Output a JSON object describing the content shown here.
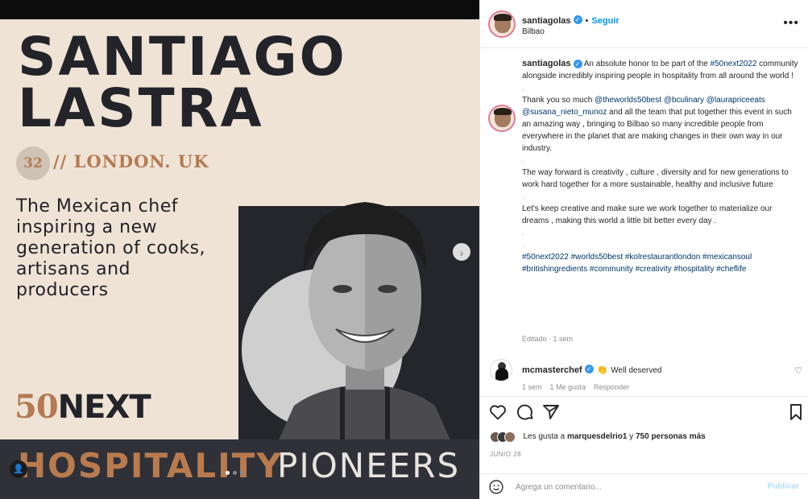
{
  "poster": {
    "name_line1": "SANTIAGO",
    "name_line2": "LASTRA",
    "number": "32",
    "location": "// LONDON. UK",
    "tagline": [
      "The Mexican chef",
      "inspiring a new",
      "generation of cooks,",
      "artisans and",
      "producers"
    ],
    "logo_number": "50",
    "logo_word": "NEXT",
    "banner_left": "HOSPITALITY",
    "banner_right": "PIONEERS"
  },
  "header": {
    "username": "santiagolas",
    "follow_label": "Seguir",
    "location": "Bilbao",
    "more_label": "•••"
  },
  "caption": {
    "username": "santiagolas",
    "intro_before": " An absolute honor to be part of the ",
    "intro_hashtag": "#50next2022",
    "intro_after": " community alongside incredibly inspiring people in hospitality from all around the world !",
    "sep": ".",
    "thanks_before": "Thank you so much ",
    "mention1": "@theworlds50best",
    "mention2": "@bculinary",
    "mention3": "@laurapriceeats",
    "mention4": "@susana_nieto_munoz",
    "thanks_after": " and all the team that put together this event in such an amazing way , bringing to Bilbao so many incredible people from everywhere in the planet that are making changes in their own way in our industry.",
    "forward": "The way forward is creativity , culture , diversity and for new generations to work hard together for a more sustainable, healthy and inclusive future",
    "keep": "Let's keep creative and make sure we work together to materialize our dreams , making this world a little bit better every day .",
    "hashtags": "#50next2022 #worlds50best #kolrestaurantlondon #mexicansoul #britishingredients #community #creativity #hospitality #cheflife",
    "meta": "Editado · 1 sem"
  },
  "comment": {
    "username": "mcmasterchef",
    "emoji": "👏",
    "text": "Well deserved",
    "meta_time": "1 sem",
    "meta_likes": "1 Me gusta",
    "meta_reply": "Responder"
  },
  "likes": {
    "prefix": "Les gusta a ",
    "user": "marquesdelrio1",
    "suffix": " y ",
    "count": "750 personas más"
  },
  "date": "JUNIO 28",
  "add_comment": {
    "placeholder": "Agrega un comentario...",
    "publish_label": "Publicar"
  },
  "icons": {
    "next": "›",
    "user_tag": "👤",
    "heart": "♡"
  },
  "colors": {
    "poster_bg": "#efe3d6",
    "accent_copper": "#b47a52",
    "dark": "#23242a",
    "link_blue": "#00376b",
    "follow_blue": "#0095f6"
  }
}
